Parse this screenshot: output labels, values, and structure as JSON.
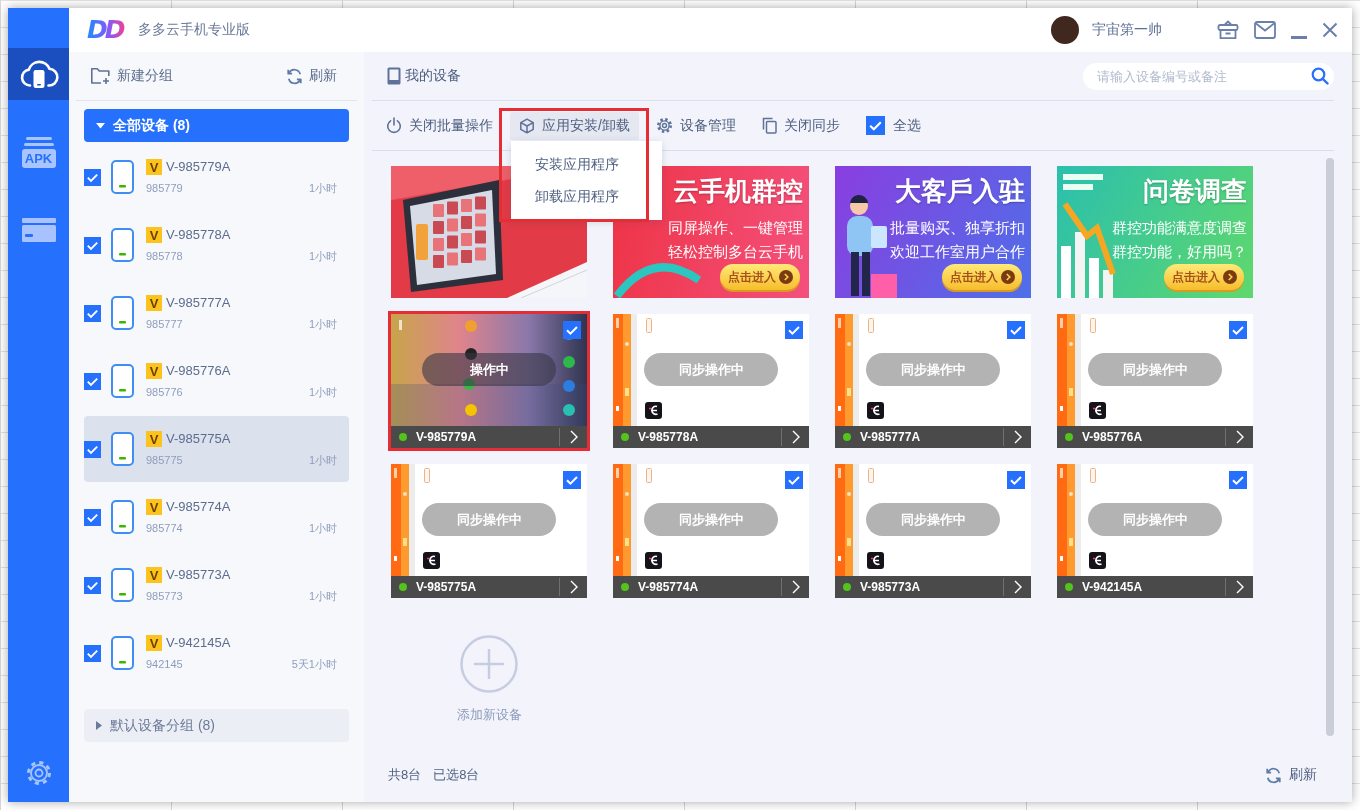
{
  "window": {
    "logo": "DD",
    "title": "多多云手机专业版",
    "user": {
      "name": "宇宙第一帅"
    }
  },
  "nav": [
    {
      "kind": "cloud",
      "selected": true
    },
    {
      "kind": "apk",
      "label": "APK",
      "selected": false
    },
    {
      "kind": "card",
      "selected": false
    }
  ],
  "sidebar": {
    "actions": [
      {
        "kind": "new-group",
        "label": "新建分组"
      },
      {
        "kind": "refresh",
        "label": "刷新"
      }
    ],
    "groups": [
      {
        "label": "全部设备 (8)",
        "selected": true,
        "expanded": true,
        "devices": [
          {
            "badge": "V",
            "name": "V-985779A",
            "id": "985779",
            "time": "1小时",
            "checked": true,
            "online": true,
            "highlighted": false
          },
          {
            "badge": "V",
            "name": "V-985778A",
            "id": "985778",
            "time": "1小时",
            "checked": true,
            "online": true,
            "highlighted": false
          },
          {
            "badge": "V",
            "name": "V-985777A",
            "id": "985777",
            "time": "1小时",
            "checked": true,
            "online": true,
            "highlighted": false
          },
          {
            "badge": "V",
            "name": "V-985776A",
            "id": "985776",
            "time": "1小时",
            "checked": true,
            "online": true,
            "highlighted": false
          },
          {
            "badge": "V",
            "name": "V-985775A",
            "id": "985775",
            "time": "1小时",
            "checked": true,
            "online": true,
            "highlighted": true
          },
          {
            "badge": "V",
            "name": "V-985774A",
            "id": "985774",
            "time": "1小时",
            "checked": true,
            "online": true,
            "highlighted": false
          },
          {
            "badge": "V",
            "name": "V-985773A",
            "id": "985773",
            "time": "1小时",
            "checked": true,
            "online": true,
            "highlighted": false
          },
          {
            "badge": "V",
            "name": "V-942145A",
            "id": "942145",
            "time": "5天1小时",
            "checked": true,
            "online": true,
            "highlighted": false
          }
        ]
      },
      {
        "label": "默认设备分组 (8)",
        "selected": false,
        "expanded": false
      }
    ]
  },
  "main": {
    "title": "我的设备",
    "search": {
      "placeholder": "请输入设备编号或备注"
    },
    "toolbar": [
      {
        "kind": "power",
        "label": "关闭批量操作",
        "highlighted": false
      },
      {
        "kind": "cube",
        "label": "应用安装/卸载",
        "expanded": true,
        "highlighted": true,
        "menu": [
          "安装应用程序",
          "卸载应用程序"
        ]
      },
      {
        "kind": "gear",
        "label": "设备管理",
        "highlighted": false
      },
      {
        "kind": "copy",
        "label": "关闭同步",
        "highlighted": false
      },
      {
        "kind": "checkbox",
        "label": "全选",
        "checked": true,
        "highlighted": false
      }
    ],
    "banners": [
      {
        "kind": "tablet"
      },
      {
        "kind": "phones",
        "title": "云手机群控",
        "lines": [
          "同屏操作、一键管理",
          "轻松控制多台云手机"
        ],
        "button": "点击进入"
      },
      {
        "kind": "person",
        "title": "大客戶入驻",
        "lines": [
          "批量购买、独享折扣",
          "欢迎工作室用户合作"
        ],
        "button": "点击进入"
      },
      {
        "kind": "chart",
        "title": "问卷调查",
        "lines": [
          "群控功能满意度调查",
          "群控功能，好用吗？"
        ],
        "button": "点击进入"
      }
    ],
    "devices": [
      {
        "kind": "home",
        "name": "V-985779A",
        "status": "操作中",
        "checked": true,
        "online": true,
        "highlighted": true
      },
      {
        "kind": "app",
        "name": "V-985778A",
        "status": "同步操作中",
        "checked": true,
        "online": true,
        "highlighted": false
      },
      {
        "kind": "app",
        "name": "V-985777A",
        "status": "同步操作中",
        "checked": true,
        "online": true,
        "highlighted": false
      },
      {
        "kind": "app",
        "name": "V-985776A",
        "status": "同步操作中",
        "checked": true,
        "online": true,
        "highlighted": false
      },
      {
        "kind": "app",
        "name": "V-985775A",
        "status": "同步操作中",
        "checked": true,
        "online": true,
        "highlighted": false
      },
      {
        "kind": "app",
        "name": "V-985774A",
        "status": "同步操作中",
        "checked": true,
        "online": true,
        "highlighted": false
      },
      {
        "kind": "app",
        "name": "V-985773A",
        "status": "同步操作中",
        "checked": true,
        "online": true,
        "highlighted": false
      },
      {
        "kind": "app",
        "name": "V-942145A",
        "status": "同步操作中",
        "checked": true,
        "online": true,
        "highlighted": false
      }
    ],
    "add_device": {
      "label": "添加新设备"
    },
    "footer": {
      "total": "共8台",
      "selected": "已选8台",
      "refresh": "刷新"
    }
  }
}
